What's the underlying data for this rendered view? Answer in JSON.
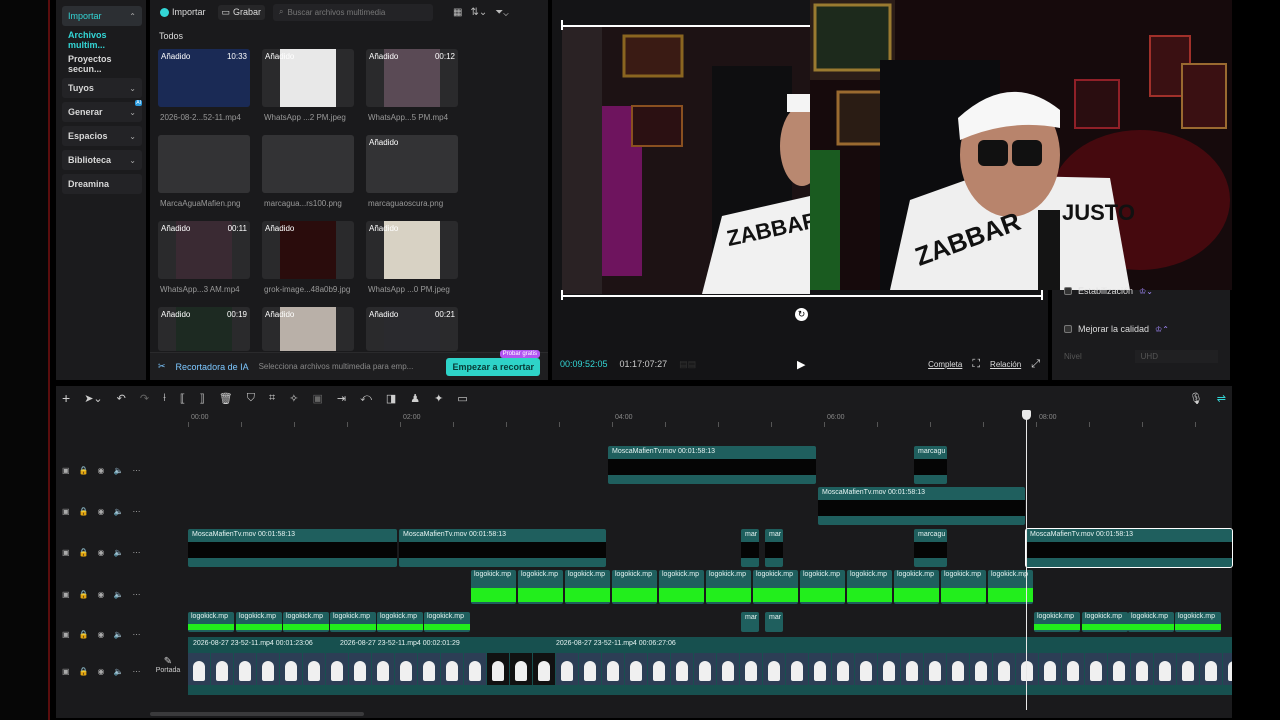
{
  "sidebar": {
    "items": [
      {
        "label": "Importar",
        "chevron": "⌃"
      },
      {
        "label": "Archivos multim..."
      },
      {
        "label": "Proyectos secun..."
      },
      {
        "label": "Tuyos",
        "chevron": "⌄"
      },
      {
        "label": "Generar",
        "chevron": "⌄",
        "badge": "AI"
      },
      {
        "label": "Espacios",
        "chevron": "⌄"
      },
      {
        "label": "Biblioteca",
        "chevron": "⌄"
      },
      {
        "label": "Dreamina"
      }
    ]
  },
  "media": {
    "import_label": "Importar",
    "record_label": "Grabar",
    "search_placeholder": "Buscar archivos multimedia",
    "filter_label": "Todos",
    "thumbs": [
      {
        "tag": "Añadido",
        "dur": "10:33",
        "caption": "2026-08-2...52-11.mp4"
      },
      {
        "tag": "Añadido",
        "dur": "",
        "caption": "WhatsApp ...2 PM.jpeg"
      },
      {
        "tag": "Añadido",
        "dur": "00:12",
        "caption": "WhatsApp...5 PM.mp4"
      },
      {
        "tag": "",
        "dur": "",
        "caption": "MarcaAguaMafien.png"
      },
      {
        "tag": "",
        "dur": "",
        "caption": "marcagua...rs100.png"
      },
      {
        "tag": "Añadido",
        "dur": "",
        "caption": "marcaguaoscura.png"
      },
      {
        "tag": "Añadido",
        "dur": "00:11",
        "caption": "WhatsApp...3 AM.mp4"
      },
      {
        "tag": "Añadido",
        "dur": "",
        "caption": "grok-image...48a0b9.jpg"
      },
      {
        "tag": "Añadido",
        "dur": "",
        "caption": "WhatsApp ...0 PM.jpeg"
      },
      {
        "tag": "Añadido",
        "dur": "00:19",
        "caption": ""
      },
      {
        "tag": "Añadido",
        "dur": "",
        "caption": ""
      },
      {
        "tag": "Añadido",
        "dur": "00:21",
        "caption": ""
      }
    ],
    "recortadora": {
      "label": "Recortadora de IA",
      "desc": "Selecciona archivos multimedia para emp...",
      "button": "Empezar a recortar",
      "badge": "Probar gratis"
    }
  },
  "player": {
    "current_time": "00:09:52:05",
    "total_time": "01:17:07:27",
    "complete_label": "Completa",
    "ratio_label": "Relación"
  },
  "props": {
    "stabilization": "Estabilización",
    "improve_quality": "Mejorar la calidad",
    "level_label": "Nivel",
    "level_value": "UHD"
  },
  "timeline": {
    "ruler": [
      "00:00",
      "02:00",
      "04:00",
      "06:00",
      "08:00"
    ],
    "clips_row1": [
      {
        "label": "MoscaMafienTv.mov   00:01:58:13"
      },
      {
        "label": "marcagu"
      }
    ],
    "clips_row2": [
      {
        "label": "MoscaMafienTv.mov   00:01:58:13"
      }
    ],
    "clips_row3": [
      {
        "label": "MoscaMafienTv.mov   00:01:58:13"
      },
      {
        "label": "MoscaMafienTv.mov   00:01:58:13"
      },
      {
        "label": "mar"
      },
      {
        "label": "mar"
      },
      {
        "label": "marcagu"
      },
      {
        "label": "MoscaMafienTv.mov   00:01:58:13"
      }
    ],
    "green_label": "logokick.mp",
    "green_label_alt": "logokick.mp",
    "main_labels": [
      "2026-08-27 23-52-11.mp4   00:01:23:06",
      "2026-08-27 23-52-11.mp4   00:02:01:29",
      "2026-08-27 23-52-11.mp4   00:06:27:06"
    ],
    "cover_label": "Portada"
  }
}
